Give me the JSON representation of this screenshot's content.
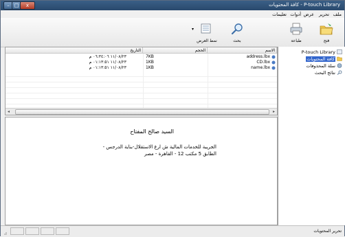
{
  "window": {
    "title": "P-touch Library - كافة المحتويات",
    "close_label": "x",
    "max_label": "□",
    "min_label": "–"
  },
  "menu": [
    {
      "id": "file",
      "label": "ملف"
    },
    {
      "id": "edit",
      "label": "تحرير"
    },
    {
      "id": "view",
      "label": "عرض"
    },
    {
      "id": "tools",
      "label": "أدوات"
    },
    {
      "id": "help",
      "label": "تعليمات"
    }
  ],
  "toolbar": {
    "open_label": "فتح",
    "print_label": "طباعة",
    "search_label": "بحث",
    "view_style_label": "نمط العرض"
  },
  "tree": {
    "root": "P-touch Library",
    "items": [
      {
        "label": "كافة المحتويات",
        "selected": true,
        "icon": "folder-icon"
      },
      {
        "label": "سلة المحذوفات",
        "selected": false,
        "icon": "recycle-bin-icon"
      },
      {
        "label": "نتائج البحث",
        "selected": false,
        "icon": "search-results-icon"
      }
    ]
  },
  "list": {
    "columns": {
      "name": "الاسم",
      "size": "الحجم",
      "date": "التاريخ"
    },
    "rows": [
      {
        "name": "address.lbx",
        "size": "7KB",
        "date": "١١/٠٨/٢٣ ٠٦:٣٤:٠٦ م"
      },
      {
        "name": "CD.lbx",
        "size": "1KB",
        "date": "١١/٠٨/٢٣ ٠١:١٣:٥١ م"
      },
      {
        "name": "name.lbx",
        "size": "1KB",
        "date": "١١/٠٨/٢٣ ٠١:١٣:٥١ م"
      }
    ]
  },
  "preview": {
    "heading": "السيد صالح المفتاح",
    "body": "الجريبة للخدمات المالية ش ارع الاستقلال-بناية الدرجس - الطابق 5 مكتب 12 - القاهرة - مصر"
  },
  "status": {
    "text": "تحرير المحتويات"
  },
  "colors": {
    "titlebar": "#2f5278",
    "selection": "#3366cc"
  }
}
